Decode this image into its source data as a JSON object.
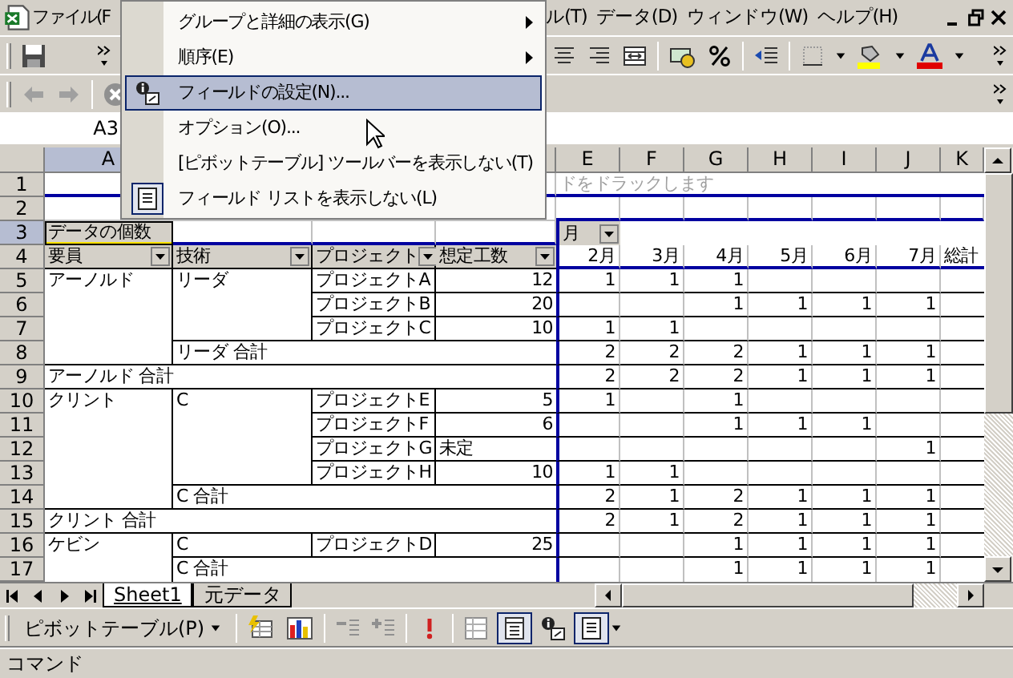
{
  "menu_bar": {
    "items": [
      "ファイル(F",
      "ル(T)",
      "データ(D)",
      "ウィンドウ(W)",
      "ヘルプ(H)"
    ]
  },
  "name_box": {
    "value": "A3"
  },
  "sheet": {
    "columns": [
      {
        "label": "A",
        "selected": true
      },
      {},
      {},
      {},
      {
        "label": "E",
        "selected": false
      },
      {
        "label": "F",
        "selected": false
      },
      {
        "label": "G",
        "selected": false
      },
      {
        "label": "H",
        "selected": false
      },
      {
        "label": "I",
        "selected": false
      },
      {
        "label": "J",
        "selected": false
      },
      {
        "label": "K",
        "selected": false
      }
    ],
    "rows": [
      {
        "number": "1",
        "kind": "drop",
        "selected": false,
        "cells": [
          null,
          null,
          null,
          null,
          "ドをドラックします"
        ]
      },
      {
        "number": "2",
        "kind": "blank",
        "selected": false
      },
      {
        "number": "3",
        "kind": "fields",
        "selected": true,
        "cells": [
          {
            "text": "データの個数",
            "kind": "field",
            "dropdown": false
          },
          null,
          null,
          null,
          {
            "text": "月",
            "kind": "field",
            "dropdown": true
          }
        ]
      },
      {
        "number": "4",
        "kind": "header",
        "selected": false,
        "cells": [
          {
            "text": "要員",
            "kind": "field",
            "dropdown": true
          },
          {
            "text": "技術",
            "kind": "field",
            "dropdown": true
          },
          {
            "text": "プロジェクト",
            "kind": "field",
            "dropdown": true
          },
          {
            "text": "想定工数",
            "kind": "field",
            "dropdown": true
          },
          "2月",
          "3月",
          "4月",
          "5月",
          "6月",
          "7月",
          "総計"
        ]
      },
      {
        "number": "5",
        "kind": "data",
        "selected": false,
        "cells": [
          "アーノルド",
          "リーダ",
          "プロジェクトA",
          "12",
          "1",
          "1",
          "1"
        ]
      },
      {
        "number": "6",
        "kind": "data",
        "selected": false,
        "cells": [
          null,
          null,
          "プロジェクトB",
          "20",
          null,
          null,
          "1",
          "1",
          "1",
          "1"
        ]
      },
      {
        "number": "7",
        "kind": "data",
        "selected": false,
        "cells": [
          null,
          null,
          "プロジェクトC",
          "10",
          "1",
          "1"
        ]
      },
      {
        "number": "8",
        "kind": "data",
        "selected": false,
        "cells": [
          null,
          "リーダ 合計",
          null,
          null,
          "2",
          "2",
          "2",
          "1",
          "1",
          "1"
        ]
      },
      {
        "number": "9",
        "kind": "data",
        "selected": false,
        "cells": [
          "アーノルド 合計",
          null,
          null,
          null,
          "2",
          "2",
          "2",
          "1",
          "1",
          "1"
        ]
      },
      {
        "number": "10",
        "kind": "data",
        "selected": false,
        "cells": [
          "クリント",
          "C",
          "プロジェクトE",
          "5",
          "1",
          null,
          "1"
        ]
      },
      {
        "number": "11",
        "kind": "data",
        "selected": false,
        "cells": [
          null,
          null,
          "プロジェクトF",
          "6",
          null,
          null,
          "1",
          "1",
          "1"
        ]
      },
      {
        "number": "12",
        "kind": "data",
        "selected": false,
        "cells": [
          null,
          null,
          "プロジェクトG",
          "未定",
          null,
          null,
          null,
          null,
          null,
          "1"
        ]
      },
      {
        "number": "13",
        "kind": "data",
        "selected": false,
        "cells": [
          null,
          null,
          "プロジェクトH",
          "10",
          "1",
          "1"
        ]
      },
      {
        "number": "14",
        "kind": "data",
        "selected": false,
        "cells": [
          null,
          "C 合計",
          null,
          null,
          "2",
          "1",
          "2",
          "1",
          "1",
          "1"
        ]
      },
      {
        "number": "15",
        "kind": "data",
        "selected": false,
        "cells": [
          "クリント 合計",
          null,
          null,
          null,
          "2",
          "1",
          "2",
          "1",
          "1",
          "1"
        ]
      },
      {
        "number": "16",
        "kind": "data",
        "selected": false,
        "cells": [
          "ケビン",
          "C",
          "プロジェクトD",
          "25",
          null,
          null,
          "1",
          "1",
          "1",
          "1"
        ]
      },
      {
        "number": "17",
        "kind": "data",
        "selected": false,
        "cells": [
          null,
          "C 合計",
          null,
          null,
          null,
          null,
          "1",
          "1",
          "1",
          "1"
        ]
      }
    ]
  },
  "sheet_tabs": [
    {
      "label": "Sheet1",
      "selected": true
    },
    {
      "label": "元データ",
      "selected": false
    }
  ],
  "pivot_toolbar": {
    "menu_label": "ピボットテーブル(P)"
  },
  "status_bar": {
    "text": "コマンド"
  },
  "context_menu": {
    "items": [
      {
        "label": "グループと詳細の表示(G)",
        "kind": "submenu",
        "selected": false
      },
      {
        "label": "順序(E)",
        "kind": "submenu",
        "selected": false
      },
      {
        "label": "フィールドの設定(N)...",
        "kind": "settings",
        "selected": true
      },
      {
        "label": "オプション(O)...",
        "kind": "plain",
        "selected": false
      },
      {
        "label": "[ピボットテーブル] ツールバーを表示しない(T)",
        "kind": "plain",
        "selected": false
      },
      {
        "label": "フィールド リストを表示しない(L)",
        "kind": "list",
        "selected": false
      }
    ]
  }
}
